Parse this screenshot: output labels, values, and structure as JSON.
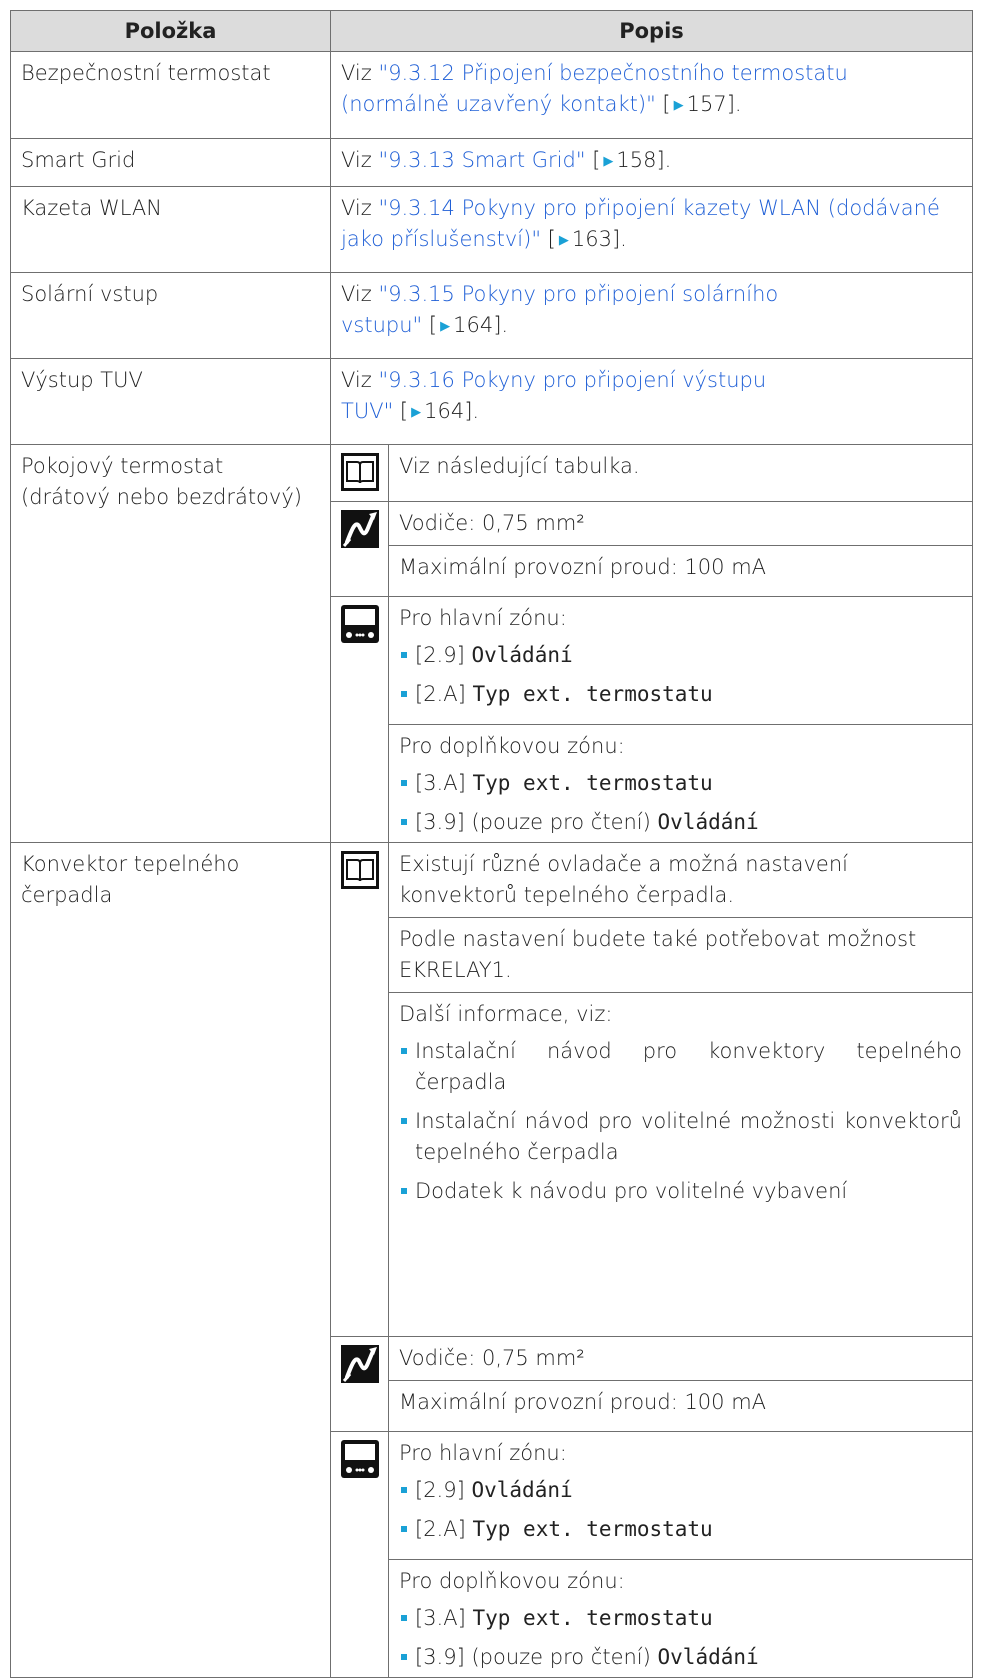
{
  "header": {
    "col1": "Položka",
    "col2": "Popis"
  },
  "viz": "Viz",
  "rows": [
    {
      "item": "Bezpečnostní termostat",
      "link": "\"9.3.12 Připojení bezpečnostního termostatu (normálně uzavřený kontakt)\"",
      "page": "157"
    },
    {
      "item": "Smart Grid",
      "link": "\"9.3.13 Smart Grid\"",
      "page": "158"
    },
    {
      "item": "Kazeta WLAN",
      "link": "\"9.3.14 Pokyny pro připojení kazety WLAN (dodávané jako příslušenství)\"",
      "page": "163"
    },
    {
      "item": "Solární vstup",
      "link": "\"9.3.15 Pokyny pro připojení solárního vstupu\"",
      "page": "164"
    },
    {
      "item": "Výstup TUV",
      "link": "\"9.3.16 Pokyny pro připojení výstupu TUV\"",
      "page": "164"
    }
  ],
  "thermostat": {
    "item": "Pokojový termostat (drátový nebo bezdrátový)",
    "book_text": "Viz následující tabulka.",
    "wire": "Vodiče: 0,75 mm²",
    "current": "Maximální provozní proud: 100 mA",
    "main_zone": "Pro hlavní zónu:",
    "m1_code": "[2.9]",
    "m1_name": "Ovládání",
    "m2_code": "[2.A]",
    "m2_name": "Typ ext. termostatu",
    "add_zone": "Pro doplňkovou zónu:",
    "a1_code": "[3.A]",
    "a1_name": "Typ ext. termostatu",
    "a2_code": "[3.9] (pouze pro čtení)",
    "a2_name": "Ovládání"
  },
  "convector": {
    "item": "Konvektor tepelného čerpadla",
    "book_p1": "Existují různé ovladače a možná nastavení konvektorů tepelného čerpadla.",
    "book_p2": "Podle nastavení budete také potřebovat možnost EKRELAY1.",
    "book_p3": "Další informace, viz:",
    "b1": "Instalační návod pro konvektory tepelného čerpadla",
    "b2": "Instalační návod pro volitelné možnosti konvektorů tepelného čerpadla",
    "b3": "Dodatek k návodu pro volitelné vybavení",
    "wire": "Vodiče: 0,75 mm²",
    "current": "Maximální provozní proud: 100 mA",
    "main_zone": "Pro hlavní zónu:",
    "m1_code": "[2.9]",
    "m1_name": "Ovládání",
    "m2_code": "[2.A]",
    "m2_name": "Typ ext. termostatu",
    "add_zone": "Pro doplňkovou zónu:",
    "a1_code": "[3.A]",
    "a1_name": "Typ ext. termostatu",
    "a2_code": "[3.9] (pouze pro čtení)",
    "a2_name": "Ovládání"
  },
  "icons": {
    "book": "book-icon",
    "wire": "wire-icon",
    "ui": "user-interface-icon"
  },
  "colors": {
    "link": "#1f5fd6",
    "bullet": "#1aa1d6",
    "header_bg": "#dcdcdc"
  }
}
